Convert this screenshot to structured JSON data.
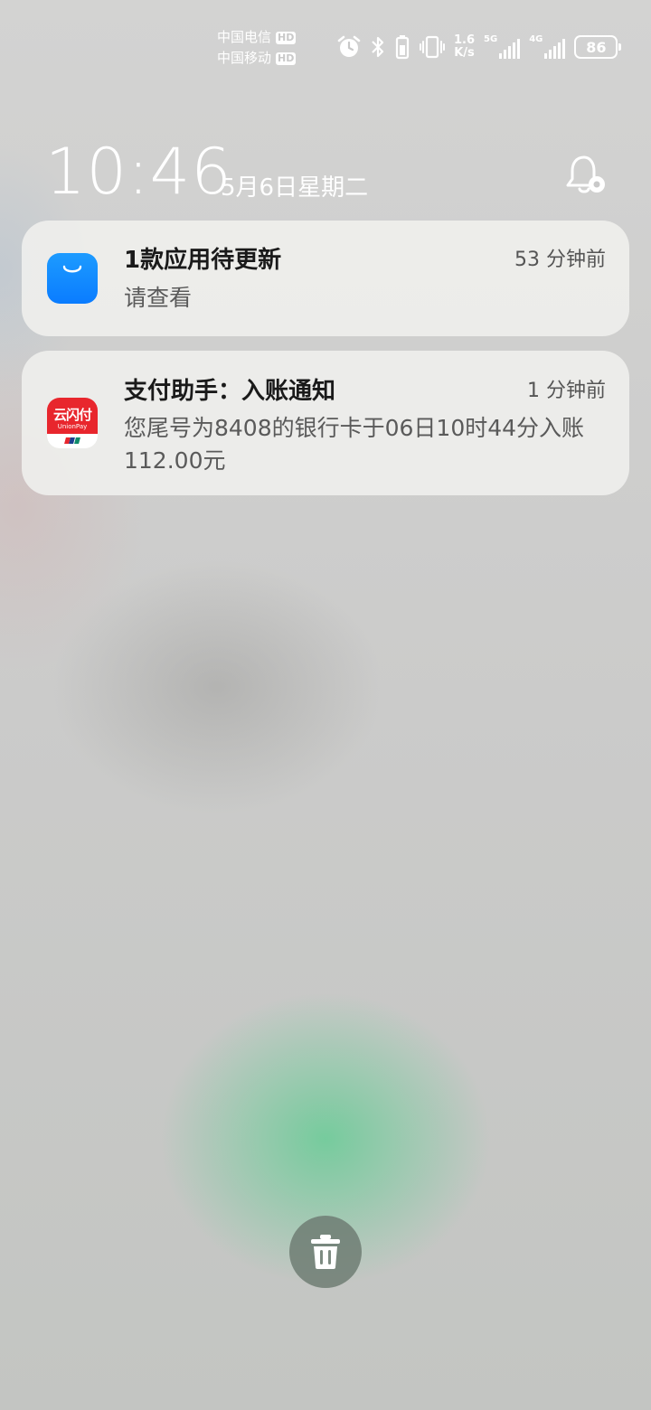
{
  "status_bar": {
    "carriers": [
      {
        "name": "中国电信",
        "badge": "HD"
      },
      {
        "name": "中国移动",
        "badge": "HD"
      }
    ],
    "icons": [
      "alarm-icon",
      "bluetooth-icon",
      "vibrate-icon"
    ],
    "speed_value": "1.6",
    "speed_unit": "K/s",
    "network1": "5G",
    "network2": "4G",
    "battery": "86"
  },
  "lockscreen": {
    "time": "10:46",
    "date": "5月6日星期二"
  },
  "notifications": [
    {
      "app_icon": "app-store-bag-icon",
      "title": "1款应用待更新",
      "time": "53 分钟前",
      "body": "请查看"
    },
    {
      "app_icon": "unionpay-icon",
      "icon_brand": "云闪付",
      "icon_sub": "UnionPay",
      "title": "支付助手：入账通知",
      "time": "1 分钟前",
      "body": "您尾号为8408的银行卡于06日10时44分入账112.00元"
    }
  ],
  "colors": {
    "accent_blue": "#0a7cff",
    "unionpay_red": "#e8262d",
    "glow_green": "#68cc96"
  }
}
